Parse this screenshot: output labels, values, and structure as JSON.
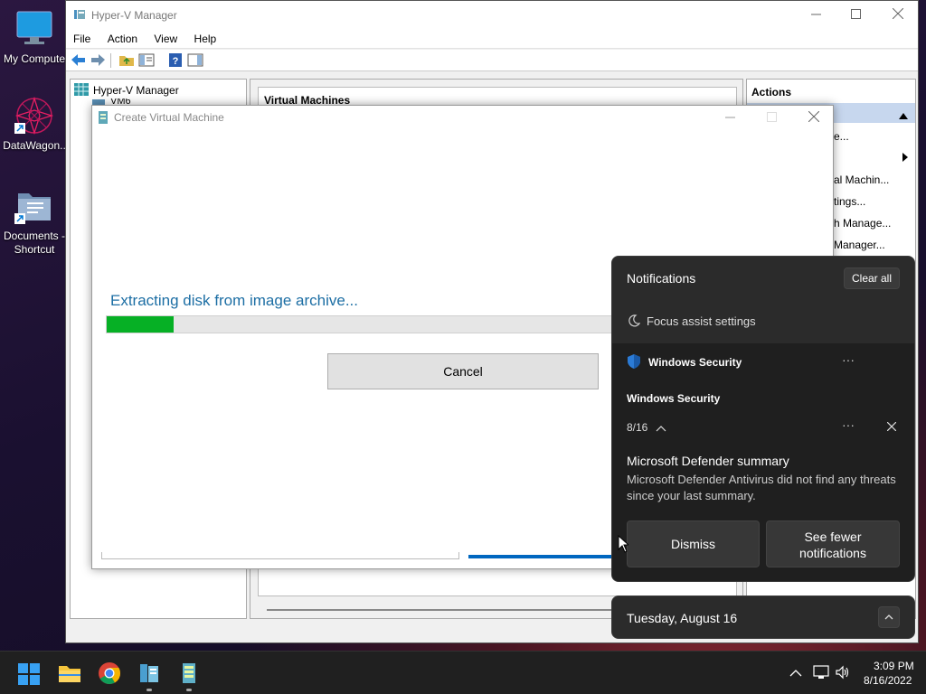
{
  "desktop": {
    "icons": [
      {
        "label": "My Compute"
      },
      {
        "label": "DataWagon.."
      },
      {
        "label": "Documents - Shortcut"
      }
    ]
  },
  "hyperv": {
    "title": "Hyper-V Manager",
    "menu": [
      "File",
      "Action",
      "View",
      "Help"
    ],
    "tree_root": "Hyper-V Manager",
    "tree_child": "VM6",
    "vm_panel_title": "Virtual Machines",
    "actions_title": "Actions",
    "actions_items": [
      "e...",
      "al Machin...",
      "tings...",
      "h Manage...",
      "Manager..."
    ]
  },
  "dialog": {
    "title": "Create Virtual Machine",
    "status_text": "Extracting disk from image archive...",
    "progress": 0.13,
    "cancel_label": "Cancel"
  },
  "notifications": {
    "header": "Notifications",
    "clear_all": "Clear all",
    "focus_assist": "Focus assist settings",
    "app_name": "Windows Security",
    "group_title": "Windows Security",
    "group_date": "8/16",
    "toast_title": "Microsoft Defender summary",
    "toast_body": "Microsoft Defender Antivirus did not find any threats since your last summary.",
    "dismiss_label": "Dismiss",
    "see_fewer_label": "See fewer notifications",
    "more_glyph": "···"
  },
  "calendar": {
    "date": "Tuesday, August 16"
  },
  "taskbar": {
    "time": "3:09 PM",
    "date": "8/16/2022"
  },
  "colors": {
    "accent_blue": "#0067c0",
    "status_text": "#1c6ea4",
    "progress_green": "#06b025"
  }
}
